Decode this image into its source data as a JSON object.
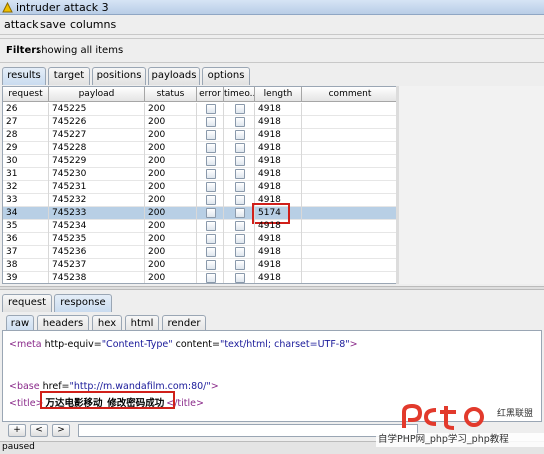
{
  "window": {
    "title": "intruder attack 3"
  },
  "menu": [
    "attack",
    "save",
    "columns"
  ],
  "filter": {
    "label": "Filter:",
    "text": "showing all items"
  },
  "top_tabs": [
    "results",
    "target",
    "positions",
    "payloads",
    "options"
  ],
  "table": {
    "columns": [
      "request",
      "payload",
      "status",
      "error",
      "timeo...",
      "length",
      "comment"
    ],
    "rows": [
      {
        "request": "26",
        "payload": "745225",
        "status": "200",
        "length": "4918"
      },
      {
        "request": "27",
        "payload": "745226",
        "status": "200",
        "length": "4918"
      },
      {
        "request": "28",
        "payload": "745227",
        "status": "200",
        "length": "4918"
      },
      {
        "request": "29",
        "payload": "745228",
        "status": "200",
        "length": "4918"
      },
      {
        "request": "30",
        "payload": "745229",
        "status": "200",
        "length": "4918"
      },
      {
        "request": "31",
        "payload": "745230",
        "status": "200",
        "length": "4918"
      },
      {
        "request": "32",
        "payload": "745231",
        "status": "200",
        "length": "4918"
      },
      {
        "request": "33",
        "payload": "745232",
        "status": "200",
        "length": "4918"
      },
      {
        "request": "34",
        "payload": "745233",
        "status": "200",
        "length": "5174",
        "selected": true
      },
      {
        "request": "35",
        "payload": "745234",
        "status": "200",
        "length": "4918"
      },
      {
        "request": "36",
        "payload": "745235",
        "status": "200",
        "length": "4918"
      },
      {
        "request": "37",
        "payload": "745236",
        "status": "200",
        "length": "4918"
      },
      {
        "request": "38",
        "payload": "745237",
        "status": "200",
        "length": "4918"
      },
      {
        "request": "39",
        "payload": "745238",
        "status": "200",
        "length": "4918"
      }
    ]
  },
  "bottom_tabs": [
    "request",
    "response"
  ],
  "view_tabs": [
    "raw",
    "headers",
    "hex",
    "html",
    "render"
  ],
  "response": {
    "line1_tag_open": "<meta",
    "line1_attr1": " http-equiv=",
    "line1_val1": "\"Content-Type\"",
    "line1_attr2": " content=",
    "line1_val2": "\"text/html; charset=UTF-8\"",
    "line1_close": ">",
    "line2_tag_open": "<base",
    "line2_attr": " href=",
    "line2_val": "\"http://m.wandafilm.com:80/\"",
    "line2_close": ">",
    "line3_open": "<title>",
    "line3_text": "万达电影移动_修改密码成功",
    "line3_close": "</title>"
  },
  "nav": {
    "plus": "+",
    "prev": "<",
    "next": ">"
  },
  "status": {
    "text": "paused"
  },
  "watermark": {
    "text1": "红黑联盟",
    "text2": "自学PHP网_php学习_php教程"
  },
  "colors": {
    "highlight": "#d0201a",
    "selected_row": "#b8cfe5",
    "tab_active": "#c9dbef"
  }
}
